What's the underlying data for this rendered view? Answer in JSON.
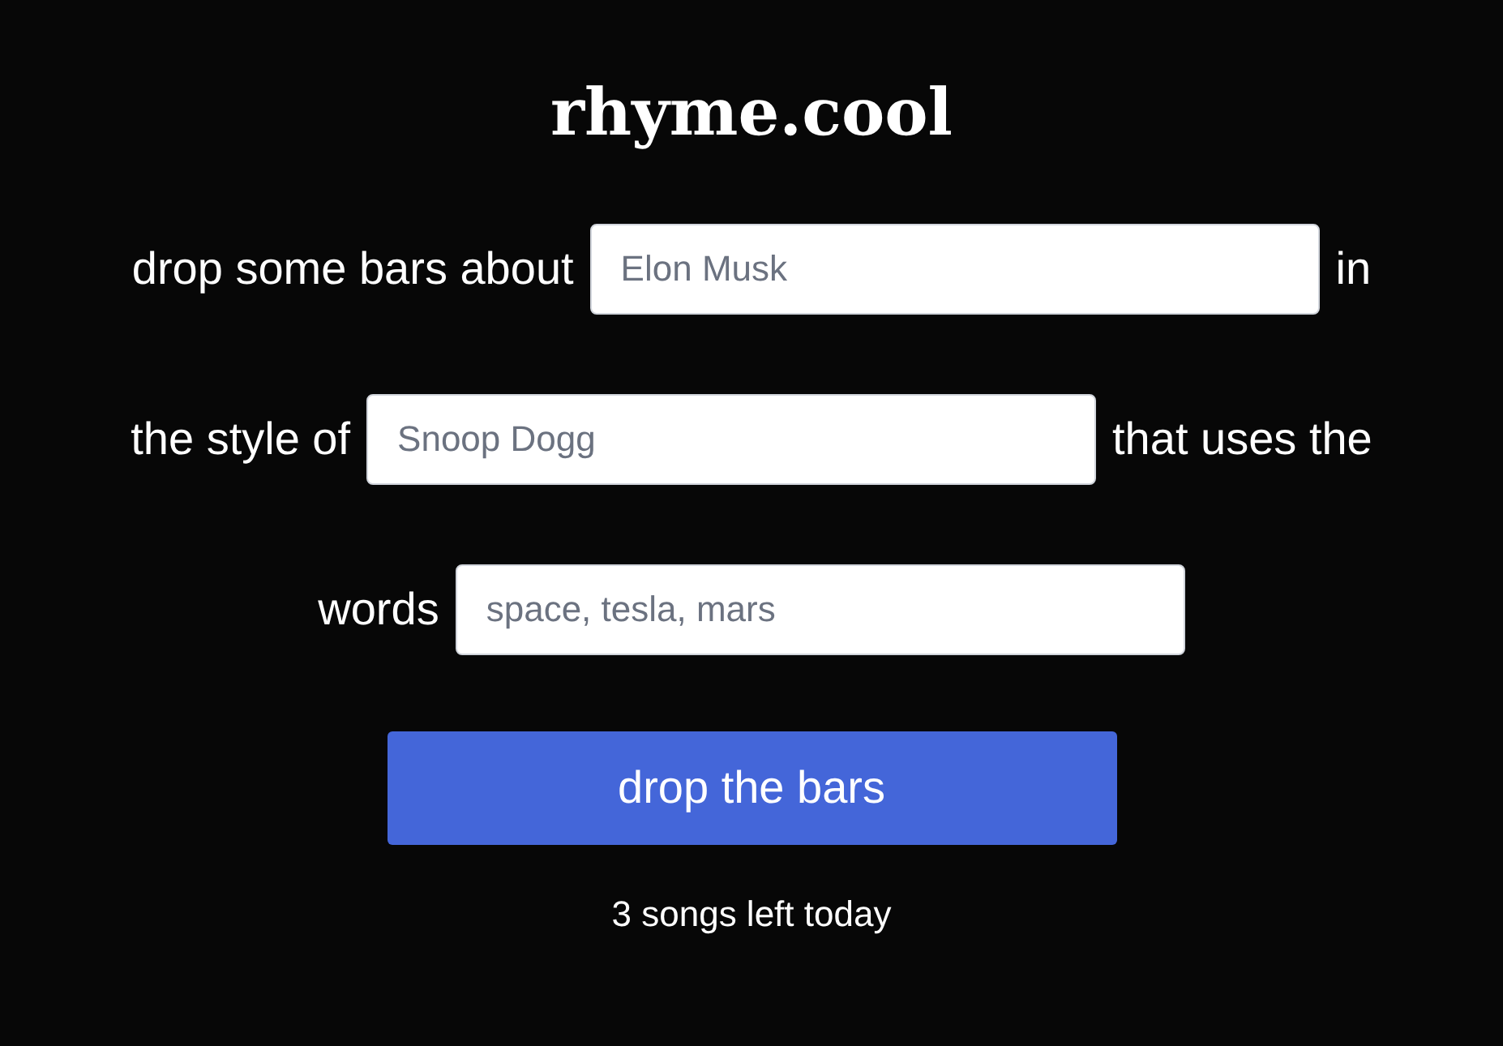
{
  "title": "rhyme.cool",
  "lines": [
    {
      "parts": [
        {
          "kind": "text",
          "text": "drop some bars about"
        },
        {
          "kind": "field",
          "placeholder": "Elon Musk"
        },
        {
          "kind": "text",
          "text": "in"
        }
      ]
    },
    {
      "parts": [
        {
          "kind": "text",
          "text": "the style of"
        },
        {
          "kind": "field",
          "placeholder": "Snoop Dogg"
        },
        {
          "kind": "text",
          "text": "that uses the"
        }
      ]
    },
    {
      "parts": [
        {
          "kind": "text",
          "text": "words"
        },
        {
          "kind": "field",
          "placeholder": "space, tesla, mars"
        }
      ]
    }
  ],
  "button": "drop the bars",
  "footer": "3 songs left today"
}
